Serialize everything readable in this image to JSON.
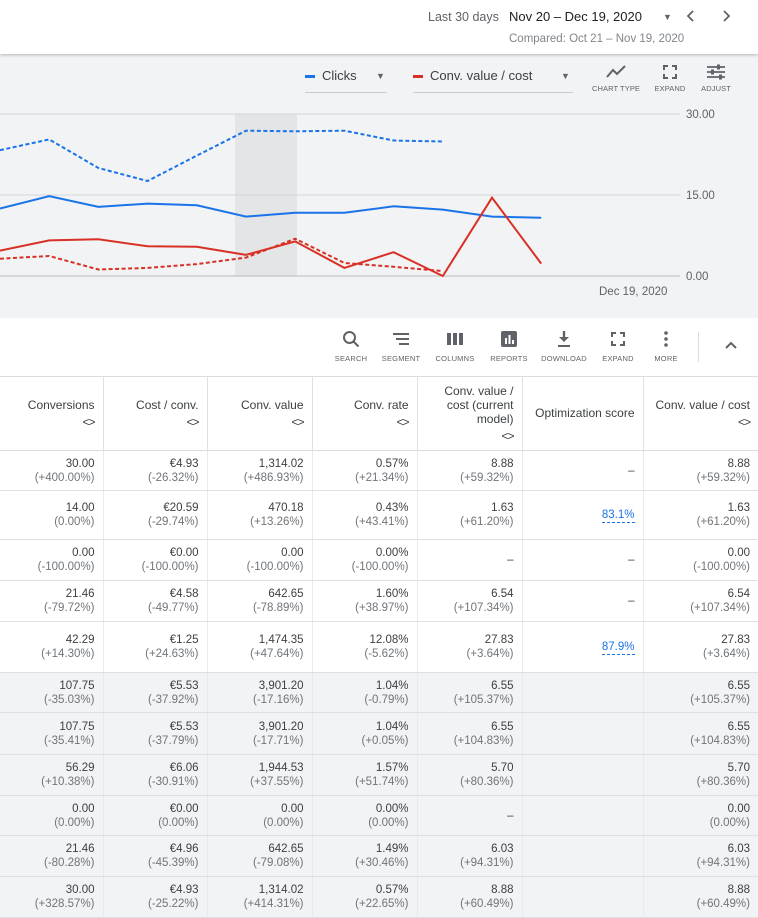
{
  "date_range": {
    "label": "Last 30 days",
    "value": "Nov 20 – Dec 19, 2020",
    "compared": "Compared: Oct 21 – Nov 19, 2020"
  },
  "chart_panel": {
    "metric1": {
      "label": "Clicks",
      "color": "#1a73e8"
    },
    "metric2": {
      "label": "Conv. value / cost",
      "color": "#d93025"
    },
    "tools": {
      "chart_type": "CHART TYPE",
      "expand": "EXPAND",
      "adjust": "ADJUST"
    }
  },
  "chart_data": {
    "type": "line",
    "y_ticks": [
      "30.00",
      "15.00",
      "0.00"
    ],
    "ylim": [
      0,
      30
    ],
    "x_label": "Dec 19, 2020",
    "series": [
      {
        "name": "Clicks",
        "style": "solid",
        "color": "#1a73e8",
        "values": [
          12.5,
          14.8,
          12.8,
          13.4,
          13.1,
          11.0,
          11.7,
          11.7,
          12.9,
          12.3,
          11.0,
          10.8
        ]
      },
      {
        "name": "Clicks (compared)",
        "style": "dashed",
        "color": "#1a73e8",
        "values": [
          23.3,
          25.3,
          20.0,
          17.6,
          22.3,
          26.9,
          26.8,
          26.9,
          25.1,
          24.9
        ]
      },
      {
        "name": "Conv. value / cost",
        "style": "solid",
        "color": "#d93025",
        "values": [
          4.7,
          6.6,
          6.8,
          5.5,
          5.4,
          3.9,
          6.4,
          1.5,
          4.4,
          0.0,
          14.5,
          2.3
        ]
      },
      {
        "name": "Conv. value / cost (compared)",
        "style": "dashed",
        "color": "#d93025",
        "values": [
          3.2,
          3.7,
          1.2,
          1.5,
          2.2,
          3.4,
          6.9,
          2.4,
          1.7,
          0.9
        ]
      }
    ]
  },
  "toolbar": {
    "search": "SEARCH",
    "segment": "SEGMENT",
    "columns": "COLUMNS",
    "reports": "REPORTS",
    "download": "DOWNLOAD",
    "expand": "EXPAND",
    "more": "MORE"
  },
  "table": {
    "sort_glyph": "<>",
    "headers": [
      "Conversions",
      "Cost / conv.",
      "Conv. value",
      "Conv. rate",
      "Conv. value / cost (current model)",
      "Optimization score",
      "Conv. value / cost"
    ],
    "rows": [
      {
        "grey": false,
        "cells": [
          [
            "30.00",
            "(+400.00%)"
          ],
          [
            "€4.93",
            "(-26.32%)"
          ],
          [
            "1,314.02",
            "(+486.93%)"
          ],
          [
            "0.57%",
            "(+21.34%)"
          ],
          [
            "8.88",
            "(+59.32%)"
          ],
          [
            "–",
            ""
          ],
          [
            "8.88",
            "(+59.32%)"
          ]
        ]
      },
      {
        "grey": false,
        "cells": [
          [
            "14.00",
            "(0.00%)"
          ],
          [
            "€20.59",
            "(-29.74%)"
          ],
          [
            "470.18",
            "(+13.26%)"
          ],
          [
            "0.43%",
            "(+43.41%)"
          ],
          [
            "1.63",
            "(+61.20%)"
          ],
          [
            "83.1%",
            ""
          ],
          [
            "1.63",
            "(+61.20%)"
          ]
        ]
      },
      {
        "grey": false,
        "cells": [
          [
            "0.00",
            "(-100.00%)"
          ],
          [
            "€0.00",
            "(-100.00%)"
          ],
          [
            "0.00",
            "(-100.00%)"
          ],
          [
            "0.00%",
            "(-100.00%)"
          ],
          [
            "–",
            ""
          ],
          [
            "–",
            ""
          ],
          [
            "0.00",
            "(-100.00%)"
          ]
        ]
      },
      {
        "grey": false,
        "cells": [
          [
            "21.46",
            "(-79.72%)"
          ],
          [
            "€4.58",
            "(-49.77%)"
          ],
          [
            "642.65",
            "(-78.89%)"
          ],
          [
            "1.60%",
            "(+38.97%)"
          ],
          [
            "6.54",
            "(+107.34%)"
          ],
          [
            "–",
            ""
          ],
          [
            "6.54",
            "(+107.34%)"
          ]
        ]
      },
      {
        "grey": false,
        "cells": [
          [
            "42.29",
            "(+14.30%)"
          ],
          [
            "€1.25",
            "(+24.63%)"
          ],
          [
            "1,474.35",
            "(+47.64%)"
          ],
          [
            "12.08%",
            "(-5.62%)"
          ],
          [
            "27.83",
            "(+3.64%)"
          ],
          [
            "87.9%",
            ""
          ],
          [
            "27.83",
            "(+3.64%)"
          ]
        ]
      },
      {
        "grey": true,
        "cells": [
          [
            "107.75",
            "(-35.03%)"
          ],
          [
            "€5.53",
            "(-37.92%)"
          ],
          [
            "3,901.20",
            "(-17.16%)"
          ],
          [
            "1.04%",
            "(-0.79%)"
          ],
          [
            "6.55",
            "(+105.37%)"
          ],
          [
            "",
            ""
          ],
          [
            "6.55",
            "(+105.37%)"
          ]
        ]
      },
      {
        "grey": true,
        "cells": [
          [
            "107.75",
            "(-35.41%)"
          ],
          [
            "€5.53",
            "(-37.79%)"
          ],
          [
            "3,901.20",
            "(-17.71%)"
          ],
          [
            "1.04%",
            "(+0.05%)"
          ],
          [
            "6.55",
            "(+104.83%)"
          ],
          [
            "",
            ""
          ],
          [
            "6.55",
            "(+104.83%)"
          ]
        ]
      },
      {
        "grey": true,
        "cells": [
          [
            "56.29",
            "(+10.38%)"
          ],
          [
            "€6.06",
            "(-30.91%)"
          ],
          [
            "1,944.53",
            "(+37.55%)"
          ],
          [
            "1.57%",
            "(+51.74%)"
          ],
          [
            "5.70",
            "(+80.36%)"
          ],
          [
            "",
            ""
          ],
          [
            "5.70",
            "(+80.36%)"
          ]
        ]
      },
      {
        "grey": true,
        "cells": [
          [
            "0.00",
            "(0.00%)"
          ],
          [
            "€0.00",
            "(0.00%)"
          ],
          [
            "0.00",
            "(0.00%)"
          ],
          [
            "0.00%",
            "(0.00%)"
          ],
          [
            "–",
            ""
          ],
          [
            "",
            ""
          ],
          [
            "0.00",
            "(0.00%)"
          ]
        ]
      },
      {
        "grey": true,
        "cells": [
          [
            "21.46",
            "(-80.28%)"
          ],
          [
            "€4.96",
            "(-45.39%)"
          ],
          [
            "642.65",
            "(-79.08%)"
          ],
          [
            "1.49%",
            "(+30.46%)"
          ],
          [
            "6.03",
            "(+94.31%)"
          ],
          [
            "",
            ""
          ],
          [
            "6.03",
            "(+94.31%)"
          ]
        ]
      },
      {
        "grey": true,
        "cells": [
          [
            "30.00",
            "(+328.57%)"
          ],
          [
            "€4.93",
            "(-25.22%)"
          ],
          [
            "1,314.02",
            "(+414.31%)"
          ],
          [
            "0.57%",
            "(+22.65%)"
          ],
          [
            "8.88",
            "(+60.49%)"
          ],
          [
            "",
            ""
          ],
          [
            "8.88",
            "(+60.49%)"
          ]
        ]
      }
    ]
  }
}
